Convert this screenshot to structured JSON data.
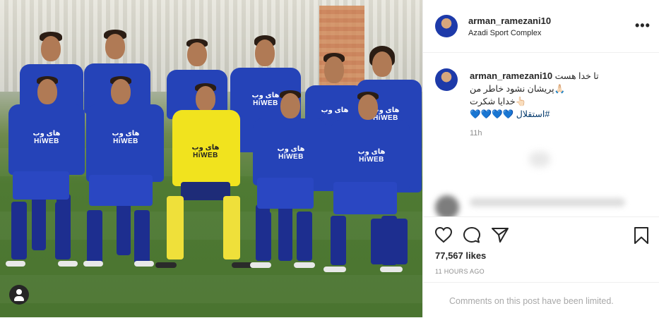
{
  "post": {
    "username": "arman_ramezani10",
    "location": "Azadi Sport Complex",
    "more_icon": "more-horizontal-icon"
  },
  "caption": {
    "username": "arman_ramezani10",
    "line1": "تا خدا هست",
    "line2": "🙏🏻پریشان نشود خاطر من",
    "line3": "👆🏻خدایا شکرت",
    "hashtag": "#استقلال",
    "hearts": "💙💙💙💙",
    "time": "11h"
  },
  "stats": {
    "likes": "77,567 likes",
    "posted": "11 HOURS AGO"
  },
  "comments_notice": "Comments on this post have been limited.",
  "photo": {
    "sponsor_text": "های وب HiWEB"
  },
  "icons": {
    "like": "heart-icon",
    "comment": "comment-icon",
    "share": "send-icon",
    "save": "bookmark-icon",
    "tags": "user-tag-icon"
  },
  "colors": {
    "kit_blue": "#2543b8",
    "gk_yellow": "#f1e31e",
    "muted_text": "#8e8e8e",
    "hashtag": "#00376b"
  }
}
